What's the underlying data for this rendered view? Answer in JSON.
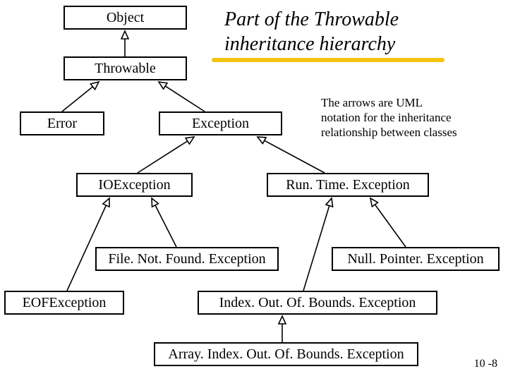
{
  "title_line1": "Part of the Throwable",
  "title_line2": "inheritance hierarchy",
  "note_line1": "The arrows are UML",
  "note_line2": "notation for the inheritance",
  "note_line3": "relationship between classes",
  "classes": {
    "object": "Object",
    "throwable": "Throwable",
    "error": "Error",
    "exception": "Exception",
    "ioexception": "IOException",
    "runtime": "Run. Time. Exception",
    "fnf": "File. Not. Found. Exception",
    "npe": "Null. Pointer. Exception",
    "eof": "EOFException",
    "ioobe": "Index. Out. Of. Bounds. Exception",
    "aioobe": "Array. Index. Out. Of. Bounds. Exception"
  },
  "slide_number": "10 -8"
}
